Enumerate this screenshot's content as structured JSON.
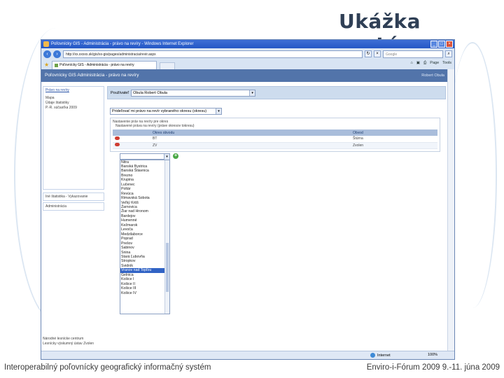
{
  "slide": {
    "title": "Ukážka systému",
    "footer_left": "Interoperabilný poľovnícky geografický informačný systém",
    "footer_right": "Enviro-i-Fórum 2009 9.-11. júna 2009"
  },
  "browser": {
    "window_title": "Poľovnícky GIS - Administrácia - právo na revíry - Windows Internet Explorer",
    "url": "http://xx.xxxxx.sk/gis/xx-gis/pages/administracia/revir.aspx",
    "search_placeholder": "Google",
    "tab_label": "Poľovnícky GIS - Administrácia - právo na revíry",
    "toolbar": {
      "page": "Page",
      "tools": "Tools"
    },
    "status": {
      "zone": "Internet",
      "zoom": "100%"
    }
  },
  "app": {
    "header": "Poľovnícky GIS   Administrácia - právo na revíry",
    "user": "Robert Obula",
    "sidebar": {
      "head": "Právo na revíry",
      "items": [
        "Mapa",
        "Údaje štatistiky",
        "P.-R. súčasťka 2009"
      ],
      "box2": "Iné štatistika - Vykazovanie",
      "box3": "Administrácia",
      "bottom_line1": "Národné lesnícke centrum",
      "bottom_line2": "Lesnícky výskumný ústav Zvolen"
    },
    "user_label": "Používateľ",
    "user_value": "Obula Robert Obula",
    "district_select": "Prideľovať mi právo na revír vybraného okresu (okresu)",
    "fieldset_legend": "Nastavenie práv na revíry pre okres",
    "fieldset_sublegend": "Nastavené práva na revíry (práve okresov tokresu)",
    "grid": {
      "headers": [
        "",
        "Okres obvodu",
        "Obvod"
      ],
      "rows": [
        {
          "code": "BT",
          "obvod": "Štúrna"
        },
        {
          "code": "ZV",
          "obvod": "Zvolen"
        }
      ]
    },
    "add_icon": "+",
    "options": [
      "Nitra",
      "Banská Bystrica",
      "Banská Štiavnica",
      "Brezno",
      "Krupina",
      "Lučenec",
      "Poltár",
      "Revúca",
      "Rimavská Sobota",
      "Veľký Krtíš",
      "Žarnovica",
      "Žiar nad Hronom",
      "Bardejov",
      "Humenné",
      "Kežmarok",
      "Levoča",
      "Medzilaborce",
      "Poprad",
      "Prešov",
      "Sabinov",
      "Snina",
      "Stará Ľubovňa",
      "Stropkov",
      "Svidník",
      "Vranov nad Topľou",
      "Gelnica",
      "Košice I",
      "Košice II",
      "Košice III",
      "Košice IV"
    ],
    "selected_option": "Vranov nad Topľou"
  }
}
